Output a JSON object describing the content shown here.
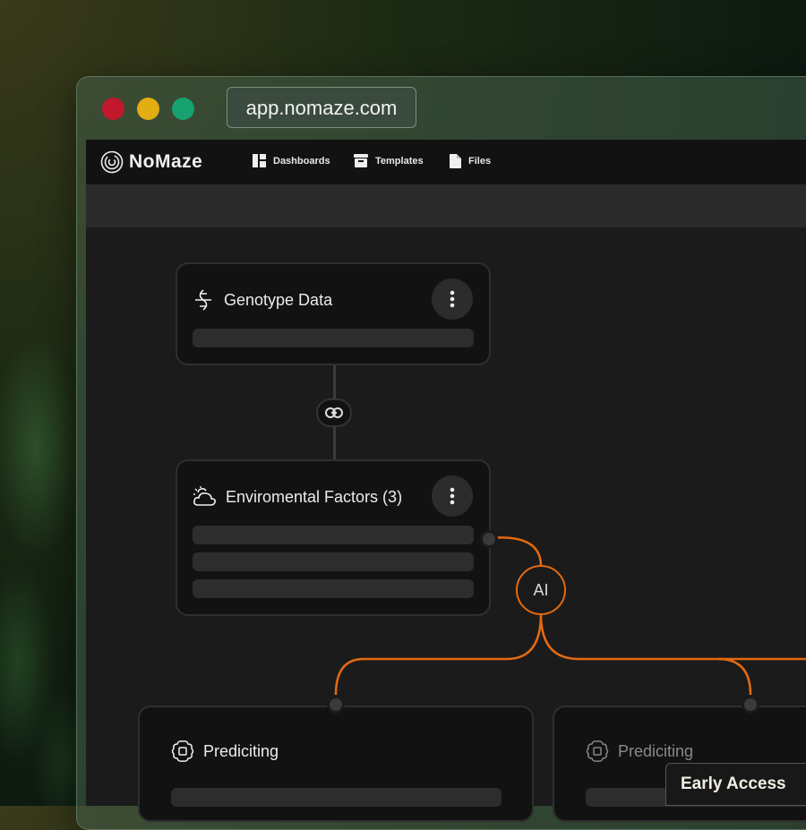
{
  "browser": {
    "url": "app.nomaze.com",
    "traffic_lights": [
      "#c2182b",
      "#e2ad10",
      "#18a170"
    ]
  },
  "nav": {
    "brand": "NoMaze",
    "items": [
      {
        "label": "Dashboards",
        "icon": "dashboard-icon"
      },
      {
        "label": "Templates",
        "icon": "archive-icon"
      },
      {
        "label": "Files",
        "icon": "file-icon"
      }
    ]
  },
  "nodes": {
    "genotype": {
      "title": "Genotype Data",
      "icon": "dna-icon"
    },
    "environment": {
      "title": "Enviromental Factors (3)",
      "icon": "cloud-sun-icon"
    },
    "ai": {
      "label": "AI"
    },
    "predict_left": {
      "title": "Prediciting",
      "icon": "brain-chip-icon"
    },
    "predict_right": {
      "title": "Prediciting",
      "icon": "brain-chip-icon"
    }
  },
  "accent_color": "#e46a10",
  "badge": {
    "label": "Early Access"
  }
}
